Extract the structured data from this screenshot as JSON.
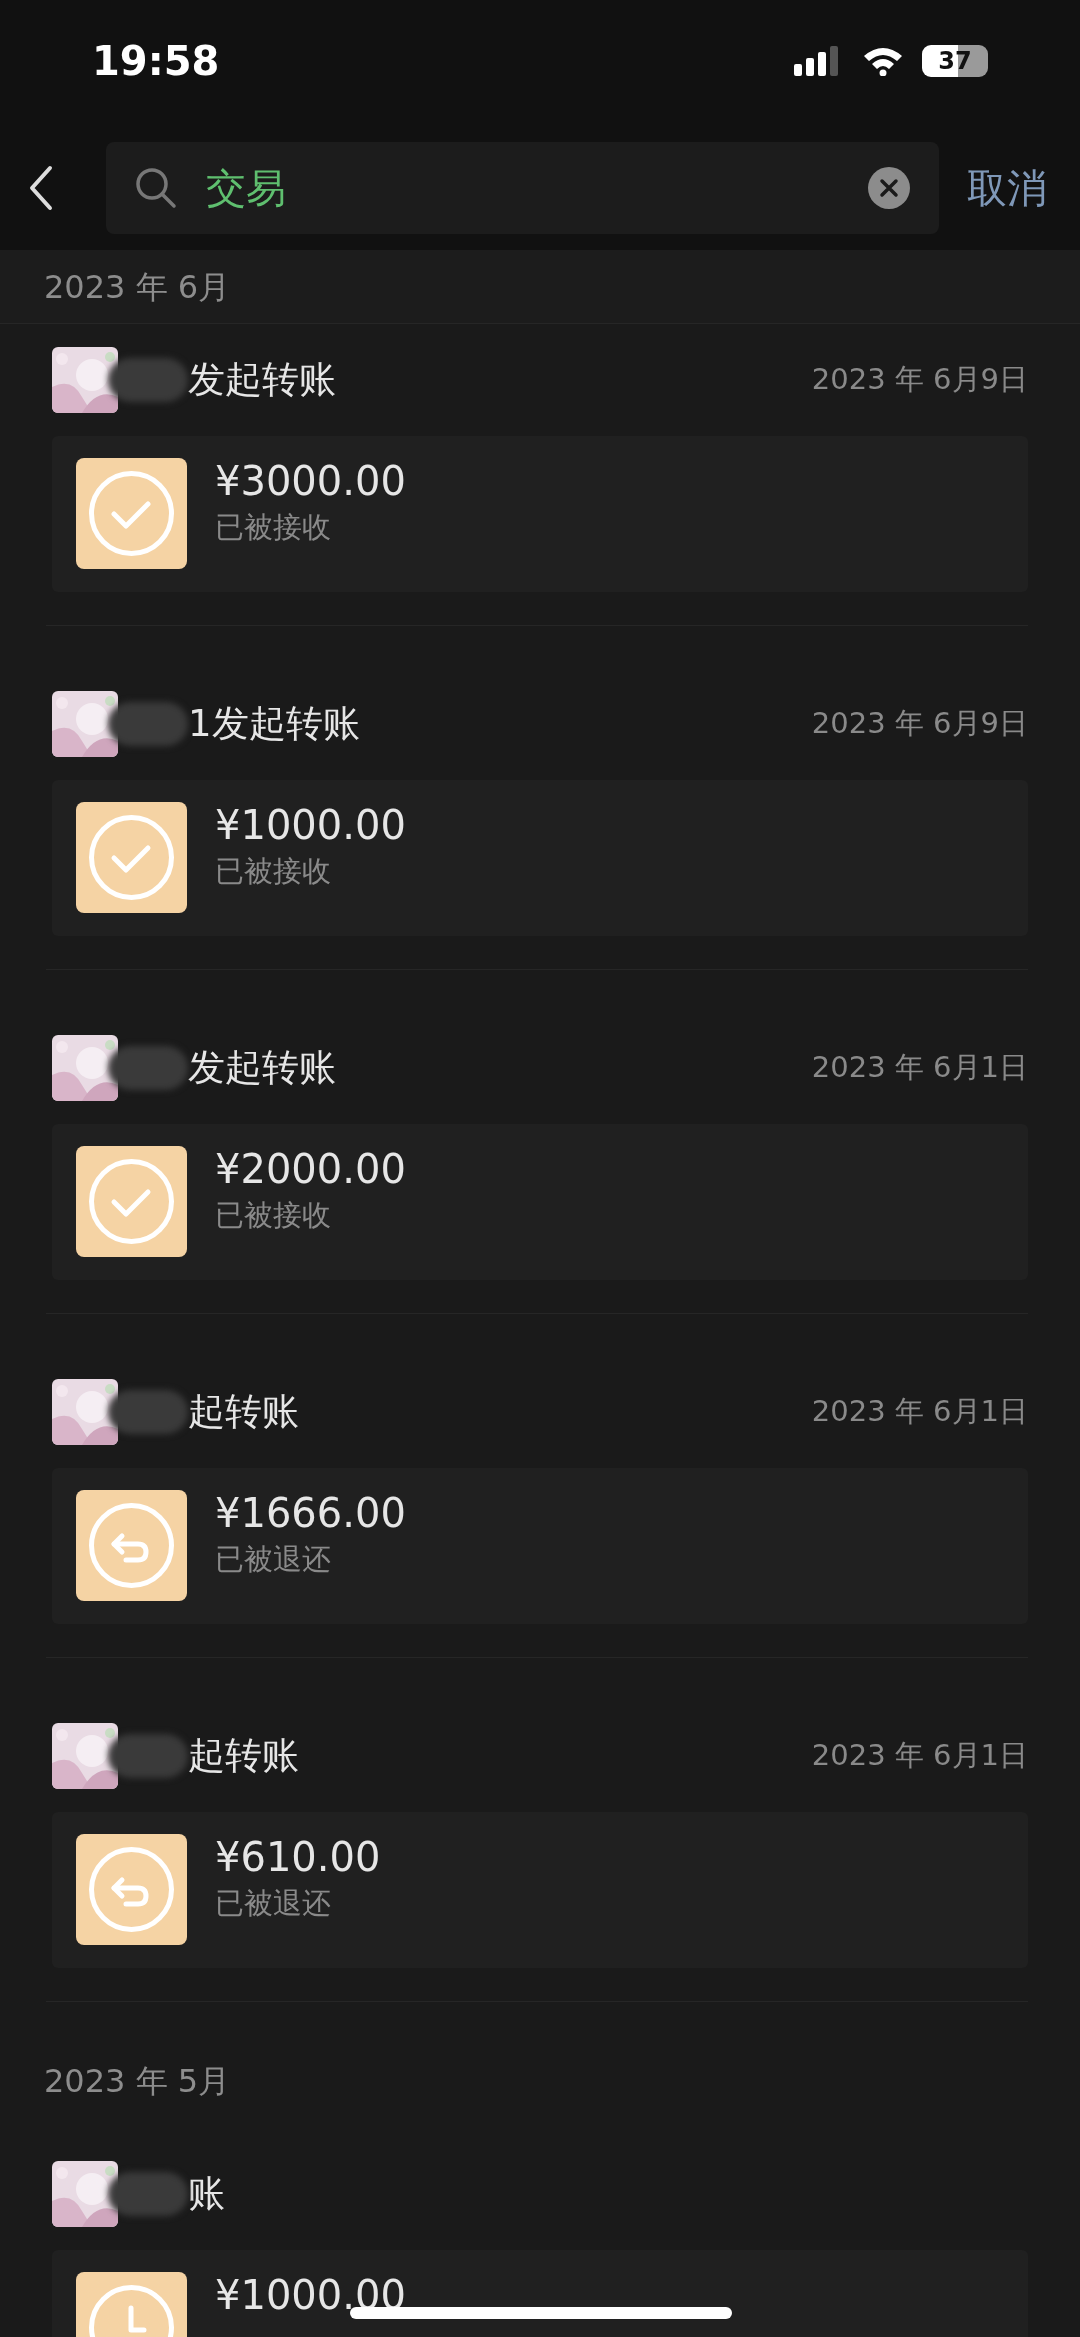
{
  "status_bar": {
    "time": "19:58",
    "battery": "37"
  },
  "search": {
    "value": "交易",
    "cancel": "取消"
  },
  "sections": [
    {
      "month": "2023 年 6月",
      "items": [
        {
          "title": "发起转账",
          "date": "2023 年 6月9日",
          "amount": "¥3000.00",
          "status": "已被接收",
          "kind": "accepted"
        },
        {
          "title": "1发起转账",
          "date": "2023 年 6月9日",
          "amount": "¥1000.00",
          "status": "已被接收",
          "kind": "accepted"
        },
        {
          "title": "发起转账",
          "date": "2023 年 6月1日",
          "amount": "¥2000.00",
          "status": "已被接收",
          "kind": "accepted"
        },
        {
          "title": "起转账",
          "date": "2023 年 6月1日",
          "amount": "¥1666.00",
          "status": "已被退还",
          "kind": "returned"
        },
        {
          "title": "起转账",
          "date": "2023 年 6月1日",
          "amount": "¥610.00",
          "status": "已被退还",
          "kind": "returned"
        }
      ]
    },
    {
      "month": "2023 年 5月",
      "items": [
        {
          "title": "账",
          "amount": "¥1000.00",
          "kind": "pending"
        }
      ]
    }
  ]
}
